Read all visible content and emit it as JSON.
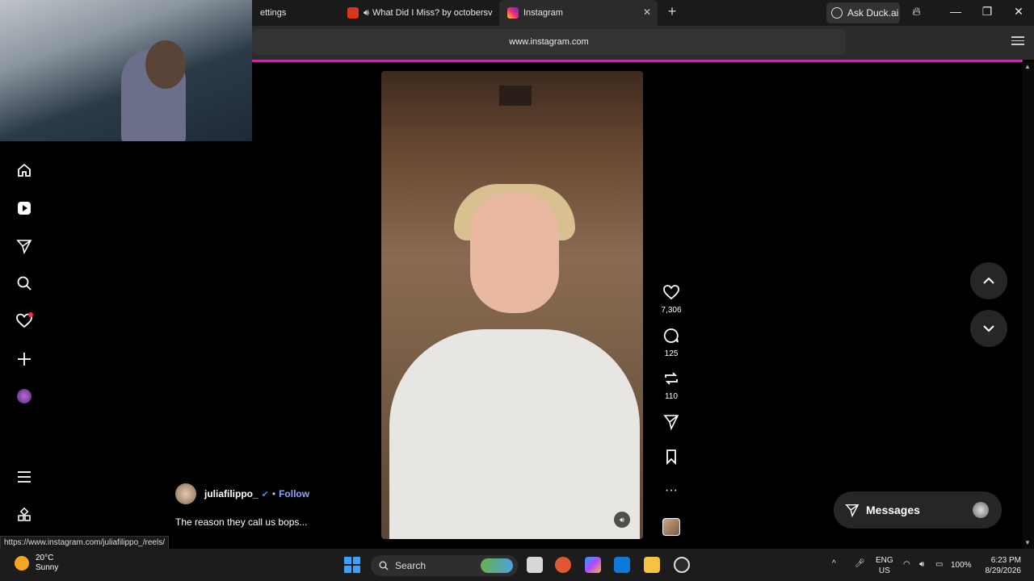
{
  "browser": {
    "tabs": [
      {
        "label": "ettings"
      },
      {
        "label": "What Did I Miss? by octobersv"
      },
      {
        "label": "Instagram"
      }
    ],
    "ask_duck_label": "Ask Duck.ai",
    "url": "www.instagram.com",
    "status_url": "https://www.instagram.com/juliafilippo_/reels/"
  },
  "sidebar": {
    "items": [
      {
        "name": "home"
      },
      {
        "name": "reels"
      },
      {
        "name": "messages"
      },
      {
        "name": "search"
      },
      {
        "name": "notifications"
      },
      {
        "name": "create"
      },
      {
        "name": "profile"
      },
      {
        "name": "more"
      },
      {
        "name": "also-from-meta"
      }
    ]
  },
  "reel": {
    "likes": "7,306",
    "comments": "125",
    "reposts": "110",
    "author": "juliafilippo_",
    "separator": "•",
    "follow_label": "Follow",
    "caption": "The reason they call us bops..."
  },
  "messages_label": "Messages",
  "taskbar": {
    "weather_temp": "20°C",
    "weather_cond": "Sunny",
    "search_label": "Search",
    "lang_top": "ENG",
    "lang_bottom": "US",
    "battery": "100%",
    "time": "6:23 PM",
    "date": "8/29/2026"
  },
  "colors": {
    "accent_progress": "#c32aa3",
    "follow": "#8aa4ff",
    "notification_dot": "#ff3040"
  }
}
